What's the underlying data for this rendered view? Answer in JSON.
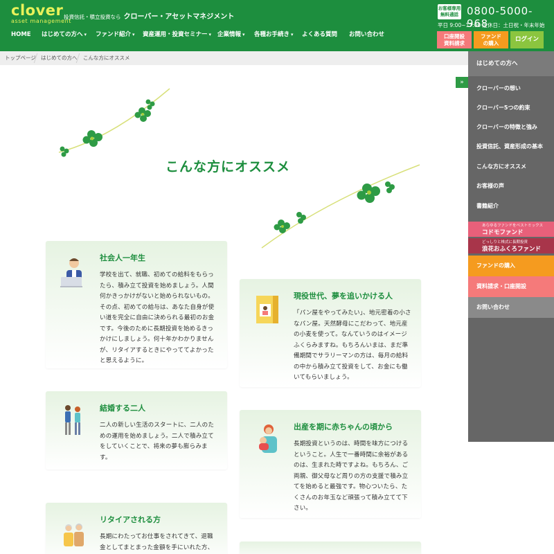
{
  "header": {
    "logo_main": "clover",
    "logo_sub": "asset management",
    "tagline_small": "投資信託・積立投資なら",
    "tagline_company": "クローバー・アセットマネジメント",
    "tel_badge_line1": "お客様専用",
    "tel_badge_line2": "無料通話",
    "tel_number": "0800-5000-968",
    "tel_hours": "平日 9:00~17:00 定休日：土日祝・年末年始",
    "btn_doc_line1": "口座開設",
    "btn_doc_line2": "資料請求",
    "btn_buy_line1": "ファンド",
    "btn_buy_line2": "の購入",
    "btn_login": "ログイン",
    "colors": {
      "brand_green": "#1d8e3e",
      "logo_yellow": "#e9f25a",
      "doc_pink": "#f57a7a",
      "buy_orange": "#f59b1f",
      "login_green": "#8bc53f"
    }
  },
  "nav": [
    {
      "label": "HOME",
      "has_caret": false
    },
    {
      "label": "はじめての方へ",
      "has_caret": true
    },
    {
      "label": "ファンド紹介",
      "has_caret": true
    },
    {
      "label": "資産運用・投資セミナー",
      "has_caret": true
    },
    {
      "label": "企業情報",
      "has_caret": true
    },
    {
      "label": "各種お手続き",
      "has_caret": true
    },
    {
      "label": "よくある質問",
      "has_caret": false
    },
    {
      "label": "お問い合わせ",
      "has_caret": false
    }
  ],
  "breadcrumb": [
    "トップページ",
    "はじめての方へ",
    "こんな方にオススメ"
  ],
  "sidebar": {
    "header": "はじめての方へ",
    "items": [
      "クローバーの想い",
      "クローバー5つの約束",
      "クローバーの特徴と強み",
      "投資信託、資産形成の基本",
      "こんな方にオススメ",
      "お客様の声",
      "書籍紹介"
    ],
    "funds": [
      {
        "sub": "あらゆるファンドをベストミックス",
        "name": "コドモファンド",
        "color": "#e8607a"
      },
      {
        "sub": "どっしりと株式に長期投資",
        "name": "浪花おふくろファンド",
        "color": "#a8354a"
      }
    ],
    "cta": [
      {
        "label": "ファンドの購入",
        "color": "#f59b1f"
      },
      {
        "label": "資料請求・口座開設",
        "color": "#f57a7a"
      },
      {
        "label": "お問い合わせ",
        "color": "#8a8a8a"
      }
    ],
    "toggle_icon": "double-chevron-right-icon"
  },
  "page": {
    "title": "こんな方にオススメ"
  },
  "cards": [
    {
      "icon": "businessman-laptop-icon",
      "title": "社会人一年生",
      "body": "学校を出て、就職、初めての給料をもらったら、積み立て投資を始めましょう。人間何かきっかけがないと始められないもの。その点、初めての給与は、あなた自身が使い道を完全に自由に決められる最初のお金です。今後のために長期投資を始めるきっかけにしましょう。何十年かわかりませんが、リタイアするときにやっててよかったと思えるように。"
    },
    {
      "icon": "bakery-icon",
      "title": "現役世代、夢を追いかける人",
      "body": "「パン屋をやってみたい」、地元密着の小さなパン屋。天然酵母にこだわって、地元産の小麦を使って。なんていうのはイメージふくらみますね。もちろんいまは、まだ準備期間でサラリーマンの方は、毎月の給料の中から積み立て投資をして、お金にも働いてもらいましょう。"
    },
    {
      "icon": "couple-icon",
      "title": "結婚する二人",
      "body": "二人の新しい生活のスタートに、二人のための運用を始めましょう。二人で積み立てをしていくことで、将来の夢も膨らみます。"
    },
    {
      "icon": "mother-baby-icon",
      "title": "出産を期に赤ちゃんの頃から",
      "body": "長期投資というのは、時間を味方につけるということ。人生で一番時間に余裕があるのは、生まれた時ですよね。もちろん、ご両親、御父母など周りの方の支援で積み立てを始めると最強です。物心ついたら、たくさんのお年玉など頑張って積み立てて下さい。"
    },
    {
      "icon": "elderly-couple-icon",
      "title": "リタイアされる方",
      "body": "長期にわたってお仕事をされてきて、退職金としてまとまった金額を手にいれた方、"
    },
    {
      "icon": "",
      "title": "",
      "body": ""
    }
  ]
}
